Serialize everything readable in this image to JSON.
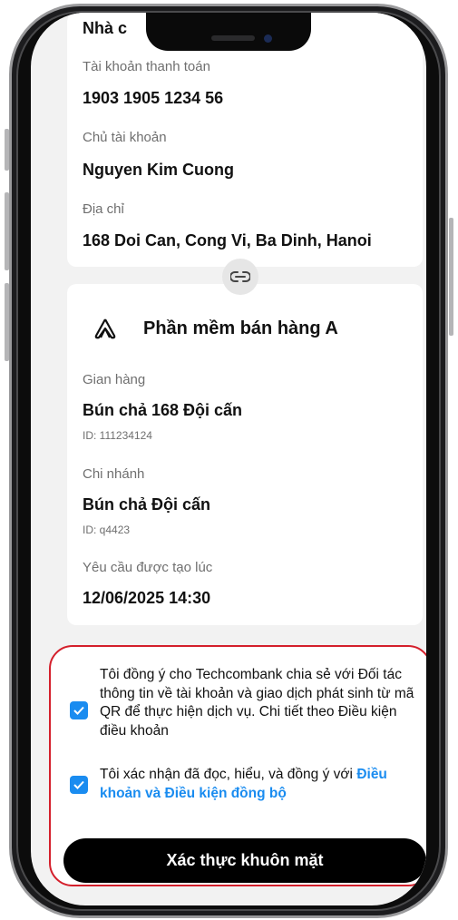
{
  "account": {
    "partial_label": "Nhà c",
    "payment_account_label": "Tài khoản thanh toán",
    "payment_account_value": "1903 1905 1234 56",
    "owner_label": "Chủ tài khoản",
    "owner_value": "Nguyen Kim Cuong",
    "address_label": "Địa chỉ",
    "address_value": "168 Doi Can, Cong Vi, Ba Dinh, Hanoi"
  },
  "partner": {
    "title": "Phần mềm bán hàng A",
    "store_label": "Gian hàng",
    "store_value": "Bún chả 168 Đội cấn",
    "store_id": "ID: 111234124",
    "branch_label": "Chi nhánh",
    "branch_value": "Bún chả Đội cấn",
    "branch_id": "ID: q4423",
    "created_label": "Yêu cầu được tạo lúc",
    "created_value": "12/06/2025 14:30"
  },
  "consent": {
    "share_text": "Tôi đồng ý cho Techcombank chia sẻ với Đối tác thông tin về tài khoản và giao dịch phát sinh từ mã QR để thực hiện dịch vụ. Chi tiết theo Điều kiện điều khoản",
    "confirm_text": "Tôi xác nhận đã đọc, hiểu, và đồng ý với ",
    "confirm_link": "Điều khoản và Điều kiện đồng bộ",
    "share_checked": true,
    "confirm_checked": true
  },
  "action": {
    "face_button_label": "Xác thực khuôn mặt"
  },
  "colors": {
    "accent": "#1a8cf0",
    "highlight_border": "#d41f2b",
    "button_bg": "#000000"
  }
}
